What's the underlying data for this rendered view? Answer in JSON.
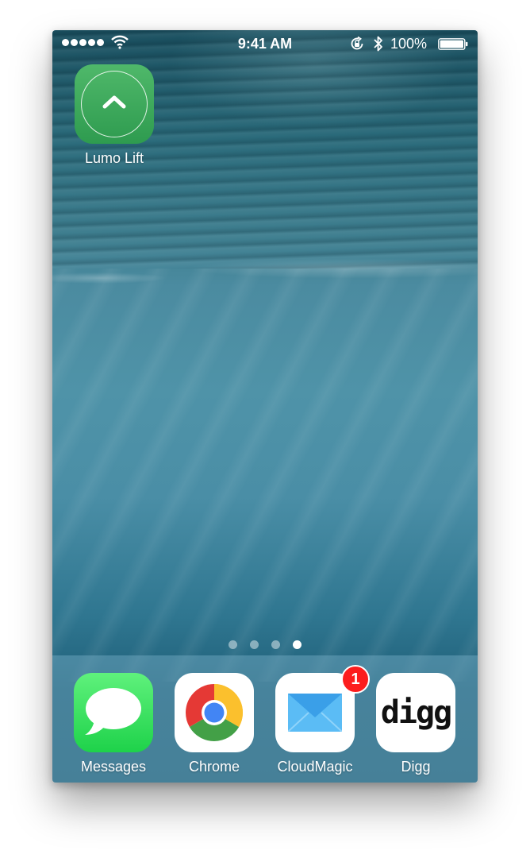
{
  "status_bar": {
    "time": "9:41 AM",
    "battery_percent": "100%",
    "signal_bars": 5,
    "icons": [
      "wifi-icon",
      "rotation-lock-icon",
      "bluetooth-icon",
      "battery-icon"
    ]
  },
  "home_apps": [
    {
      "label": "Lumo Lift",
      "icon": "lumo-lift-chevron-icon"
    }
  ],
  "page_indicator": {
    "pages": 4,
    "current": 4
  },
  "dock": {
    "apps": [
      {
        "label": "Messages",
        "icon": "speech-bubble-icon"
      },
      {
        "label": "Chrome",
        "icon": "chrome-logo-icon"
      },
      {
        "label": "CloudMagic",
        "icon": "envelope-icon",
        "badge": "1"
      },
      {
        "label": "Digg",
        "icon": "digg-logo-icon",
        "logo_text": "digg"
      }
    ]
  },
  "colors": {
    "badge": "#fc1d1d",
    "messages_green": "#1ed24a",
    "lumo_green": "#2e9b4f"
  }
}
